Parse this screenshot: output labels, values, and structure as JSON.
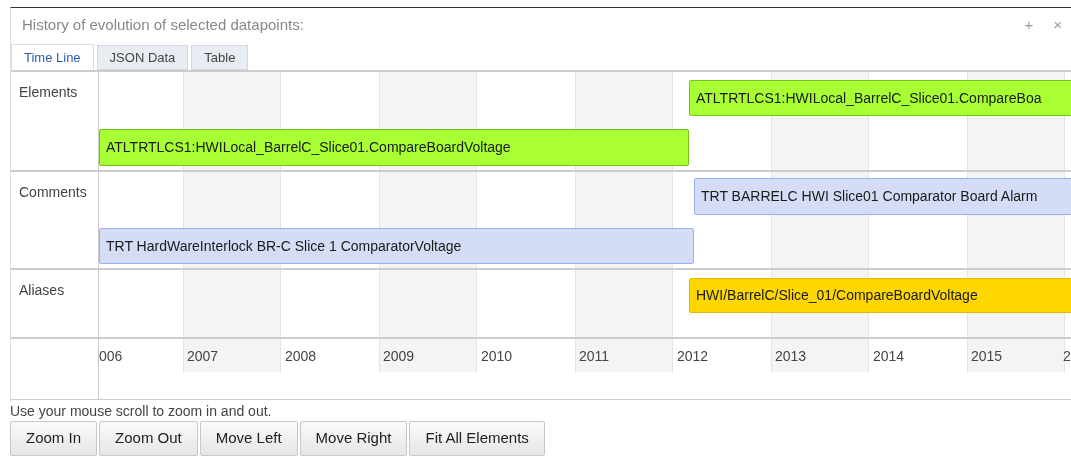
{
  "panel": {
    "title": "History of evolution of selected datapoints:",
    "controls": [
      "+",
      "×"
    ]
  },
  "tabs": [
    {
      "label": "Time Line",
      "selected": true
    },
    {
      "label": "JSON Data",
      "selected": false
    },
    {
      "label": "Table",
      "selected": false
    }
  ],
  "timeline": {
    "groups": [
      {
        "label": "Elements",
        "items": [
          {
            "text": "ATLTRTLCS1:HWILocal_BarrelC_Slice01.CompareBoa",
            "color": "#a8ff33"
          },
          {
            "text": "ATLTRTLCS1:HWILocal_BarrelC_Slice01.CompareBoardVoltage",
            "color": "#a8ff33"
          }
        ]
      },
      {
        "label": "Comments",
        "items": [
          {
            "text": "TRT BARRELC HWI Slice01 Comparator Board Alarm",
            "color": "#d5ddf6"
          },
          {
            "text": "TRT HardWareInterlock BR-C Slice 1 ComparatorVoltage",
            "color": "#d5ddf6"
          }
        ]
      },
      {
        "label": "Aliases",
        "items": [
          {
            "text": "HWI/BarrelC/Slice_01/CompareBoardVoltage",
            "color": "#ffd700"
          }
        ]
      }
    ],
    "axis_labels": [
      "006",
      "2007",
      "2008",
      "2009",
      "2010",
      "2011",
      "2012",
      "2013",
      "2014",
      "2015",
      "2"
    ]
  },
  "hint": "Use your mouse scroll to zoom in and out.",
  "buttons": [
    "Zoom In",
    "Zoom Out",
    "Move Left",
    "Move Right",
    "Fit All Elements"
  ]
}
